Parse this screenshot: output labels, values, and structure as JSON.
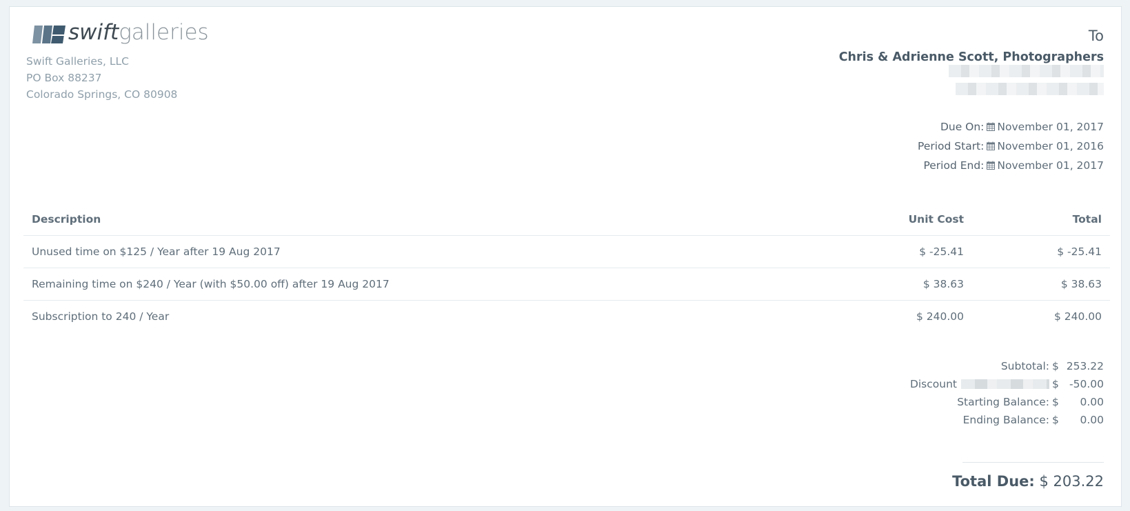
{
  "brand": {
    "logo_word_1": "swift",
    "logo_word_2": "galleries",
    "company_name": "Swift Galleries, LLC",
    "address_line_1": "PO Box 88237",
    "address_line_2": "Colorado Springs, CO 80908"
  },
  "recipient": {
    "to_label": "To",
    "name": "Chris & Adrienne Scott, Photographers"
  },
  "dates": [
    {
      "label": "Due On:",
      "value": "November 01, 2017"
    },
    {
      "label": "Period Start:",
      "value": "November 01, 2016"
    },
    {
      "label": "Period End:",
      "value": "November 01, 2017"
    }
  ],
  "table": {
    "headers": {
      "description": "Description",
      "unit_cost": "Unit Cost",
      "total": "Total"
    },
    "rows": [
      {
        "description": "Unused time on $125 / Year after 19 Aug 2017",
        "unit_cost": "$ -25.41",
        "total": "$ -25.41"
      },
      {
        "description": "Remaining time on $240 / Year (with $50.00 off) after 19 Aug 2017",
        "unit_cost": "$ 38.63",
        "total": "$ 38.63"
      },
      {
        "description": "Subscription to 240 / Year",
        "unit_cost": "$ 240.00",
        "total": "$ 240.00"
      }
    ]
  },
  "totals": {
    "currency": "$",
    "subtotal_label": "Subtotal:",
    "subtotal_value": "253.22",
    "discount_label": "Discount",
    "discount_value": "-50.00",
    "starting_balance_label": "Starting Balance:",
    "starting_balance_value": "0.00",
    "ending_balance_label": "Ending Balance:",
    "ending_balance_value": "0.00",
    "total_due_label": "Total Due:",
    "total_due_value": "$ 203.22"
  },
  "colors": {
    "logo_dark": "#3f5a6e",
    "logo_mid": "#5a7386",
    "text": "#5f6e7a",
    "heading": "#4a5a67"
  },
  "icons": {
    "date_icon": "calendar-icon"
  }
}
